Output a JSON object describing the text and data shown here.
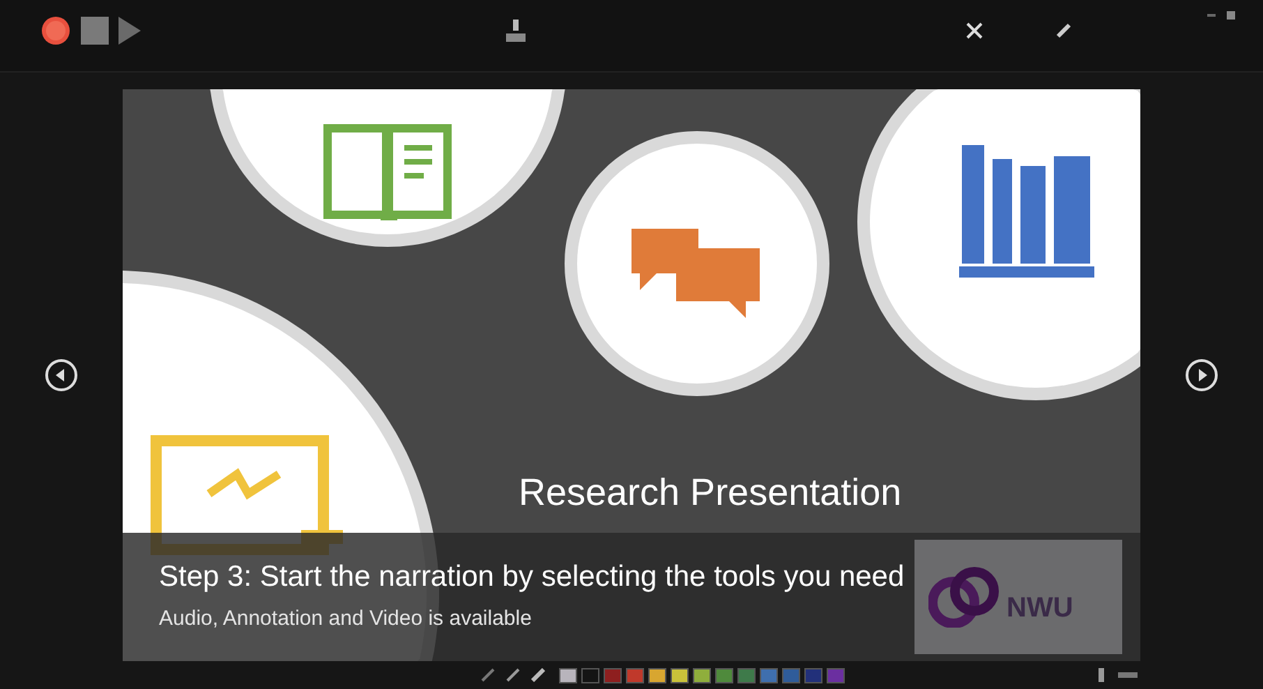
{
  "slide": {
    "title": "Research Presentation"
  },
  "caption": {
    "heading": "Step 3: Start the narration by selecting the tools you need",
    "subtext": "Audio, Annotation and Video is available"
  },
  "logo": {
    "text": "NWU"
  },
  "pen_colors": [
    {
      "color": "#b8b4bc"
    },
    {
      "color": "#141414"
    },
    {
      "color": "#8e1f1f"
    },
    {
      "color": "#c0392b"
    },
    {
      "color": "#d8a630"
    },
    {
      "color": "#c9c23a"
    },
    {
      "color": "#8fae3c"
    },
    {
      "color": "#4f8a3c"
    },
    {
      "color": "#3e7a4a"
    },
    {
      "color": "#3f6fae"
    },
    {
      "color": "#2f5c9a"
    },
    {
      "color": "#22307a"
    },
    {
      "color": "#6b2fa0"
    }
  ]
}
